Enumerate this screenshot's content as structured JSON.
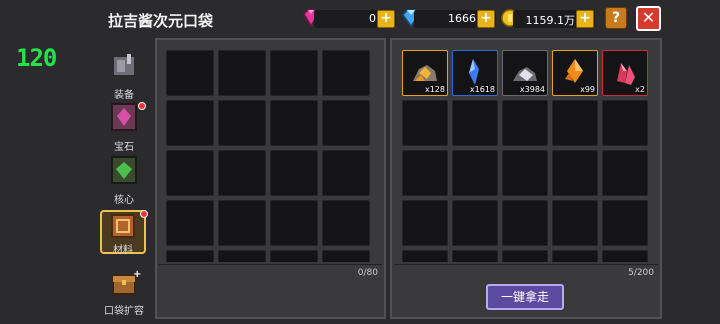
{
  "fps": "120",
  "title": "拉吉酱次元口袋",
  "currencies": [
    {
      "icon": "pink-gem-icon",
      "value": "0"
    },
    {
      "icon": "blue-diamond-icon",
      "value": "1666"
    },
    {
      "icon": "gold-coin-icon",
      "value": "1159.1万"
    }
  ],
  "help_label": "?",
  "close_label": "✕",
  "sidebar": [
    {
      "label": "装备",
      "icon": "equipment-icon",
      "dot": false
    },
    {
      "label": "宝石",
      "icon": "gem-icon",
      "dot": true
    },
    {
      "label": "核心",
      "icon": "core-icon",
      "dot": false
    },
    {
      "label": "材料",
      "icon": "material-icon",
      "dot": true,
      "selected": true
    },
    {
      "label": "口袋扩容",
      "icon": "chest-icon",
      "dot": false
    }
  ],
  "left_panel": {
    "count": "0/80"
  },
  "right_panel": {
    "count": "5/200",
    "items": [
      {
        "icon": "gold-ore-icon",
        "qty": "x128",
        "rarity_color": "#e8a020"
      },
      {
        "icon": "blue-crystal-icon",
        "qty": "x1618",
        "rarity_color": "#2a6bd8"
      },
      {
        "icon": "silver-ore-icon",
        "qty": "x3984",
        "rarity_color": "#6a6a70"
      },
      {
        "icon": "orange-crystal-icon",
        "qty": "x99",
        "rarity_color": "#e8a020"
      },
      {
        "icon": "red-crystal-icon",
        "qty": "x2",
        "rarity_color": "#d02a3a"
      }
    ]
  },
  "take_all_label": "一键拿走"
}
